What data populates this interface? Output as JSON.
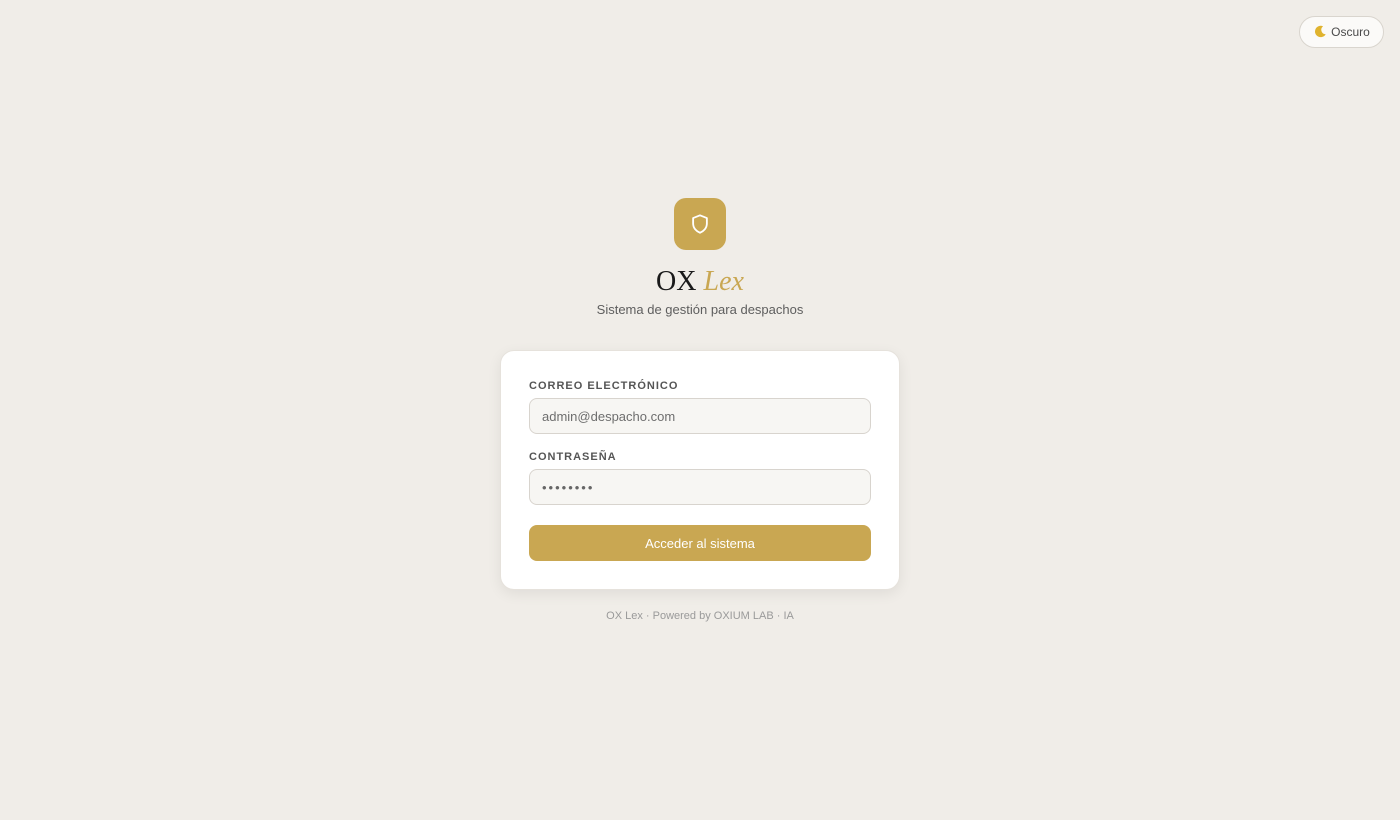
{
  "theme_toggle": {
    "label": "Oscuro",
    "icon": "moon-icon"
  },
  "brand": {
    "logo_icon": "shield-icon",
    "name_primary": "OX",
    "name_accent": "Lex",
    "subtitle": "Sistema de gestión para despachos",
    "accent_color": "#c9a752"
  },
  "login_form": {
    "email_label": "CORREO ELECTRÓNICO",
    "email_placeholder": "admin@despacho.com",
    "password_label": "CONTRASEÑA",
    "password_value": "••••••••",
    "submit_label": "Acceder al sistema"
  },
  "footer": {
    "text": "OX Lex · Powered by OXIUM LAB · IA"
  }
}
